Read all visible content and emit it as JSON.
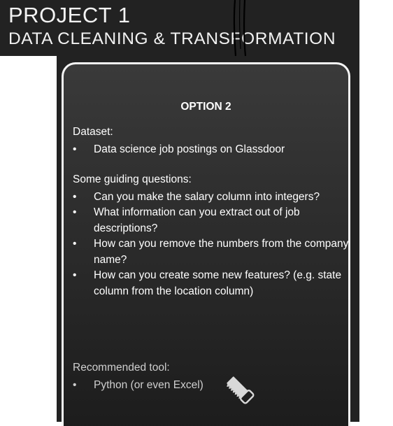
{
  "header": {
    "title_line1": "PROJECT 1",
    "title_line2": "DATA CLEANING & TRANSFORMATION"
  },
  "card": {
    "option_title": "OPTION 2",
    "dataset_label": "Dataset:",
    "dataset_items": [
      "Data science job postings on Glassdoor"
    ],
    "questions_label": "Some guiding questions:",
    "questions": [
      "Can you make the salary column into integers?",
      "What information can you extract out of job descriptions?",
      "How can you remove the numbers from the company name?",
      "How can you create some new features? (e.g. state column from the location column)"
    ],
    "tool_label": "Recommended tool:",
    "tool_items": [
      "Python (or even Excel)"
    ],
    "bullet_char": "•",
    "tool_icon": "saw-icon"
  },
  "colors": {
    "slide_background": "#222222",
    "card_border": "#f4f4f4",
    "text": "#ffffff",
    "muted_text": "#cfcfcf"
  }
}
